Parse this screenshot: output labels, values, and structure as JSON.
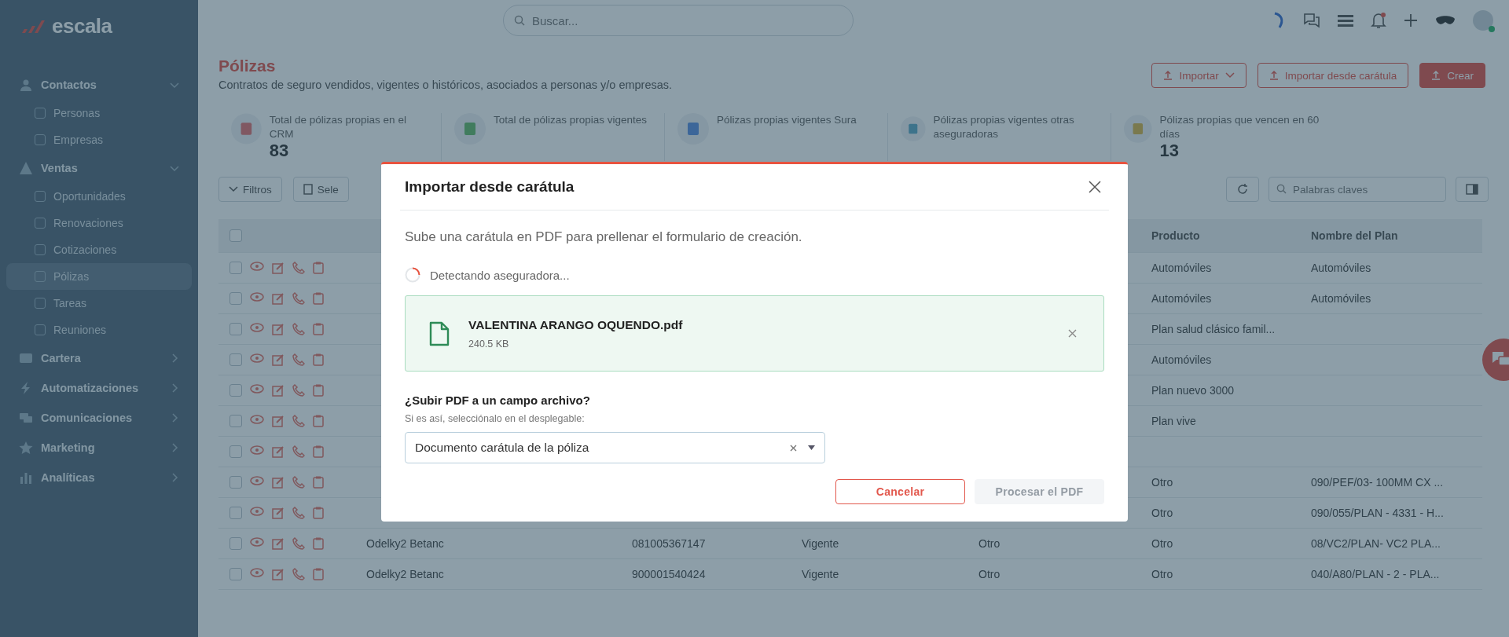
{
  "sidebar": {
    "logo": "escala",
    "groups": [
      {
        "label": "Contactos",
        "expanded": true,
        "children": [
          {
            "label": "Personas",
            "selected": false
          },
          {
            "label": "Empresas",
            "selected": false
          }
        ]
      },
      {
        "label": "Ventas",
        "expanded": true,
        "children": [
          {
            "label": "Oportunidades",
            "selected": false
          },
          {
            "label": "Renovaciones",
            "selected": false
          },
          {
            "label": "Cotizaciones",
            "selected": false
          },
          {
            "label": "Pólizas",
            "selected": true
          },
          {
            "label": "Tareas",
            "selected": false
          },
          {
            "label": "Reuniones",
            "selected": false
          }
        ]
      },
      {
        "label": "Cartera",
        "expanded": false
      },
      {
        "label": "Automatizaciones",
        "expanded": false
      },
      {
        "label": "Comunicaciones",
        "expanded": false
      },
      {
        "label": "Marketing",
        "expanded": false
      },
      {
        "label": "Analíticas",
        "expanded": false
      }
    ]
  },
  "topbar": {
    "search": {
      "placeholder": "Buscar..."
    }
  },
  "header": {
    "title": "Pólizas",
    "subtitle": "Contratos de seguro vendidos, vigentes o históricos, asociados a personas y/o empresas.",
    "buttons": [
      {
        "label": "Importar",
        "kind": "dropdown"
      },
      {
        "label": "Importar desde carátula",
        "kind": "outline"
      },
      {
        "label": "Crear",
        "kind": "primary"
      }
    ]
  },
  "stats": [
    {
      "label": "Total de pólizas propias en el CRM",
      "value": "83"
    },
    {
      "label": "Total de pólizas propias vigentes"
    },
    {
      "label": "Pólizas propias vigentes Sura"
    },
    {
      "label": "Pólizas propias vigentes otras aseguradoras"
    },
    {
      "label": "Pólizas propias que vencen en 60 días",
      "value": "13"
    }
  ],
  "toolbar": {
    "filters": "Filtros",
    "select": "Sele",
    "keywords": {
      "placeholder": "Palabras claves"
    }
  },
  "table": {
    "header_checked": false,
    "columns": [
      {
        "label": "Producto"
      },
      {
        "label": "Nombre del Plan"
      }
    ],
    "rows": [
      {
        "checked": false,
        "producto": "Automóviles",
        "plan": "Automóviles"
      },
      {
        "checked": false,
        "producto": "Automóviles",
        "plan": "Automóviles"
      },
      {
        "checked": false,
        "producto": "Plan salud clásico famil..."
      },
      {
        "checked": false,
        "producto": "Automóviles"
      },
      {
        "checked": false,
        "producto": "Plan nuevo 3000"
      },
      {
        "checked": false,
        "producto": "Plan vive"
      },
      {
        "checked": false
      },
      {
        "checked": false,
        "producto": "Otro",
        "plan": "090/PEF/03- 100MM CX ..."
      },
      {
        "checked": false,
        "producto": "Otro",
        "plan": "090/055/PLAN - 4331 - H..."
      },
      {
        "checked": false,
        "column_1": "Odelky2 Betanc",
        "column_2": "081005367147",
        "column_3": "Vigente",
        "column_4": "Otro",
        "producto": "Otro",
        "plan": "08/VC2/PLAN- VC2 PLA..."
      },
      {
        "checked": false,
        "column_1": "Odelky2 Betanc",
        "column_2": "900001540424",
        "column_3": "Vigente",
        "column_4": "Otro",
        "producto": "Otro",
        "plan": "040/A80/PLAN - 2 - PLA..."
      }
    ]
  },
  "modal": {
    "title": "Importar desde carátula",
    "description": "Sube una carátula en PDF para prellenar el formulario de creación.",
    "status": "Detectando aseguradora...",
    "file": {
      "name": "VALENTINA ARANGO OQUENDO.pdf",
      "size": "240.5 KB"
    },
    "question": "¿Subir PDF a un campo archivo?",
    "hint": "Si es así, selecciónalo en el desplegable:",
    "select": {
      "value": "Documento carátula de la póliza"
    },
    "buttons": [
      {
        "label": "Cancelar",
        "kind": "secondary",
        "disabled": false
      },
      {
        "label": "Procesar el PDF",
        "kind": "primary",
        "disabled": true
      }
    ]
  }
}
